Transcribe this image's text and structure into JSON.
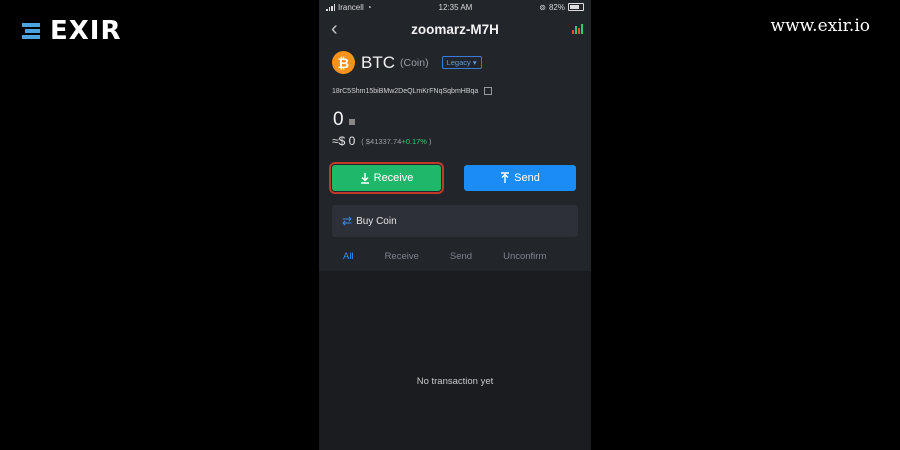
{
  "brand": {
    "logo_text": "EXIR",
    "url": "www.exir.io"
  },
  "status_bar": {
    "carrier": "Irancell",
    "time": "12:35 AM",
    "battery": "82%"
  },
  "nav": {
    "title": "zoomarz-M7H"
  },
  "coin": {
    "symbol": "BTC",
    "type": "(Coin)",
    "address_type": "Legacy ▾",
    "address": "18rC5Shm15biBMw2DeQLmKrFNqSqbmHBqa"
  },
  "balance": {
    "amount": "0",
    "fiat": "≈$ 0",
    "price_open": "( $41337.74",
    "change": "+0.17%",
    "price_close": ")"
  },
  "actions": {
    "receive_label": "Receive",
    "send_label": "Send",
    "buy_label": "Buy Coin"
  },
  "tabs": [
    {
      "label": "All",
      "active": true
    },
    {
      "label": "Receive",
      "active": false
    },
    {
      "label": "Send",
      "active": false
    },
    {
      "label": "Unconfirm",
      "active": false
    }
  ],
  "empty_message": "No transaction yet",
  "colors": {
    "receive": "#1fb86b",
    "send": "#1b8cf5",
    "highlight": "#c0392b",
    "accent": "#3a8ef0",
    "btc": "#f7931a"
  }
}
